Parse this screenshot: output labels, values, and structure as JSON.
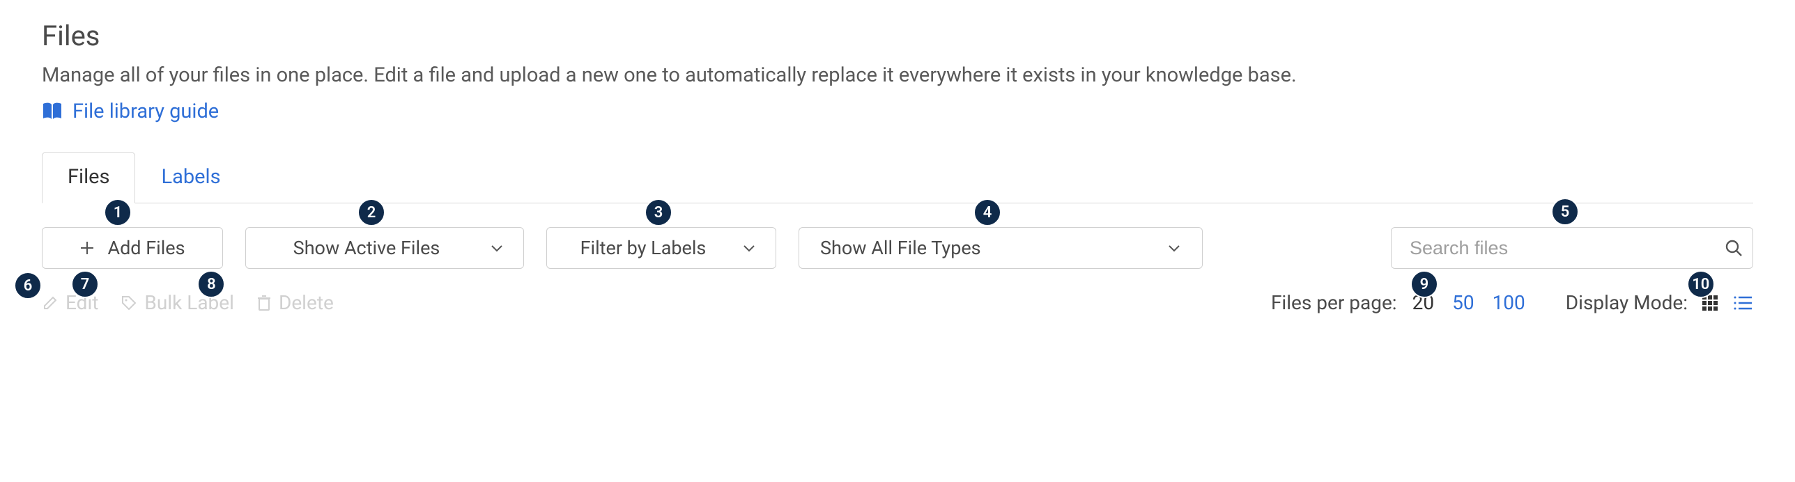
{
  "header": {
    "title": "Files",
    "description": "Manage all of your files in one place. Edit a file and upload a new one to automatically replace it everywhere it exists in your knowledge base.",
    "guide_link": "File library guide"
  },
  "tabs": {
    "files": "Files",
    "labels": "Labels"
  },
  "toolbar": {
    "add_files": "Add Files",
    "status_filter": "Show Active Files",
    "label_filter": "Filter by Labels",
    "type_filter": "Show All File Types",
    "search_placeholder": "Search files"
  },
  "bulk_actions": {
    "edit": "Edit",
    "bulk_label": "Bulk Label",
    "delete": "Delete"
  },
  "pagination": {
    "label": "Files per page:",
    "options": [
      "20",
      "50",
      "100"
    ],
    "active": "20"
  },
  "display_mode": {
    "label": "Display Mode:"
  },
  "annotations": {
    "n1": "1",
    "n2": "2",
    "n3": "3",
    "n4": "4",
    "n5": "5",
    "n6": "6",
    "n7": "7",
    "n8": "8",
    "n9": "9",
    "n10": "10"
  }
}
